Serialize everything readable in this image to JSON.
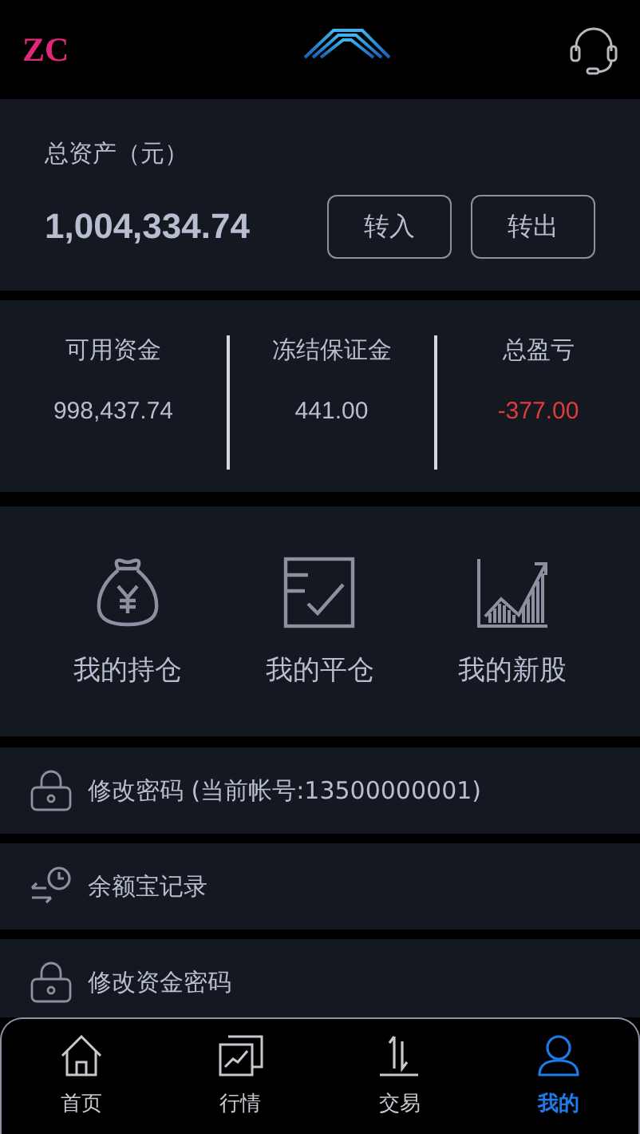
{
  "header": {
    "logo_text": "ZC"
  },
  "assets": {
    "label": "总资产（元）",
    "total": "1,004,334.74",
    "buttons": [
      "转入",
      "转出"
    ]
  },
  "stats": [
    {
      "label": "可用资金",
      "value": "998,437.74",
      "kind": "neutral"
    },
    {
      "label": "冻结保证金",
      "value": "441.00",
      "kind": "neutral"
    },
    {
      "label": "总盈亏",
      "value": "-377.00",
      "kind": "loss"
    }
  ],
  "shortcuts": [
    {
      "label": "我的持仓",
      "kind": "bag"
    },
    {
      "label": "我的平仓",
      "kind": "check"
    },
    {
      "label": "我的新股",
      "kind": "chart"
    }
  ],
  "menu": [
    {
      "label": "修改密码 (当前帐号:13500000001)",
      "kind": "lock"
    },
    {
      "label": "余额宝记录",
      "kind": "clock"
    },
    {
      "label": "修改资金密码",
      "kind": "lock"
    }
  ],
  "tabs": [
    {
      "label": "首页",
      "kind": "home",
      "selected": false
    },
    {
      "label": "行情",
      "kind": "market",
      "selected": false
    },
    {
      "label": "交易",
      "kind": "trade",
      "selected": false
    },
    {
      "label": "我的",
      "kind": "user",
      "selected": true
    }
  ]
}
